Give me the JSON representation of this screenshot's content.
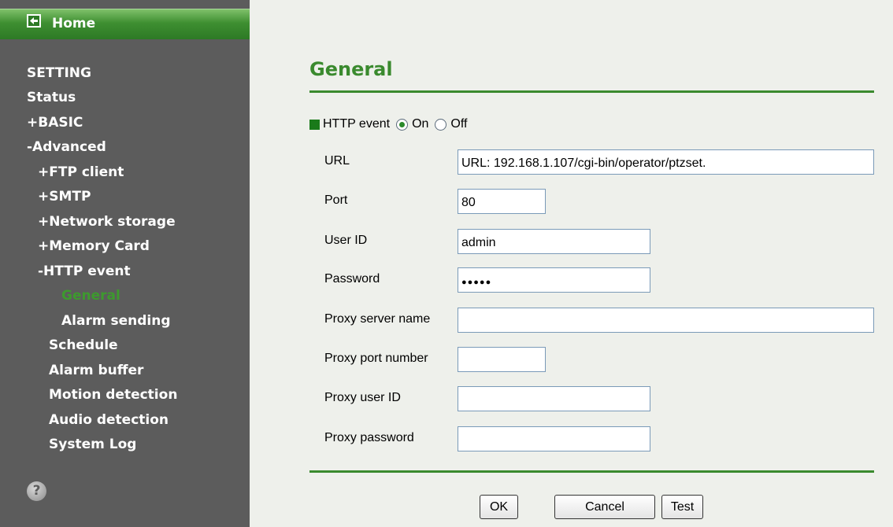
{
  "sidebar": {
    "home_label": "Home",
    "items": [
      {
        "label": "SETTING"
      },
      {
        "label": "Status"
      },
      {
        "label": "+BASIC"
      },
      {
        "label": "-Advanced"
      },
      {
        "label": "+FTP client"
      },
      {
        "label": "+SMTP"
      },
      {
        "label": "+Network storage"
      },
      {
        "label": "+Memory Card"
      },
      {
        "label": "-HTTP event"
      },
      {
        "label": "General",
        "active": true
      },
      {
        "label": "Alarm sending"
      },
      {
        "label": "Schedule"
      },
      {
        "label": "Alarm buffer"
      },
      {
        "label": "Motion detection"
      },
      {
        "label": "Audio detection"
      },
      {
        "label": "System Log"
      }
    ],
    "help_glyph": "?"
  },
  "main": {
    "title": "General",
    "http_event": {
      "label": "HTTP event",
      "on_label": "On",
      "off_label": "Off",
      "selected": "On"
    },
    "fields": [
      {
        "label": "URL",
        "value": "URL: 192.168.1.107/cgi-bin/operator/ptzset."
      },
      {
        "label": "Port",
        "value": "80"
      },
      {
        "label": "User ID",
        "value": "admin"
      },
      {
        "label": "Password",
        "value": "●●●●●"
      },
      {
        "label": "Proxy server name",
        "value": ""
      },
      {
        "label": "Proxy port number",
        "value": ""
      },
      {
        "label": "Proxy user ID",
        "value": ""
      },
      {
        "label": "Proxy password",
        "value": ""
      }
    ],
    "buttons": {
      "ok": "OK",
      "cancel": "Cancel",
      "test": "Test"
    }
  },
  "colors": {
    "accent": "#3a8a2e",
    "sidebar_bg": "#5c5c5c",
    "page_bg": "#eef0eb"
  }
}
